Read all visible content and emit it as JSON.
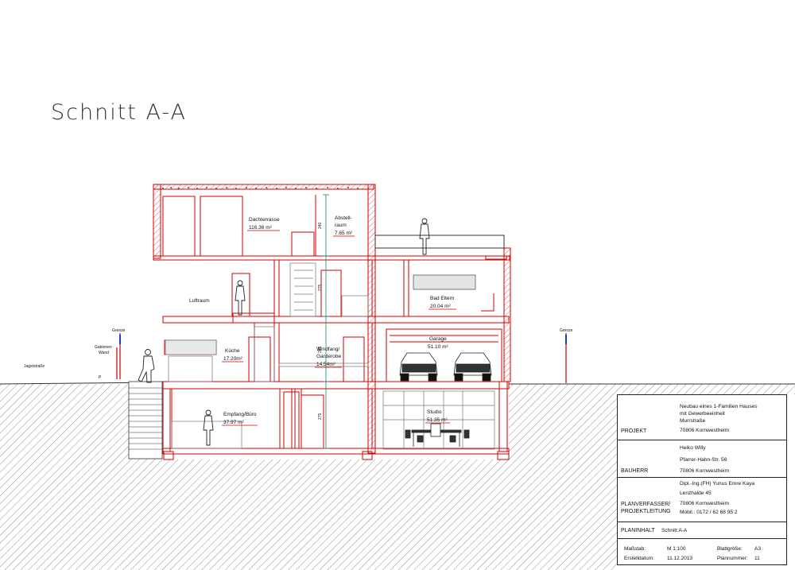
{
  "title": "Schnitt A-A",
  "rooms": {
    "dachterrasse": {
      "name": "Dachterrasse",
      "area": "116.36 m²"
    },
    "abstellraum": {
      "name": "Abstell-\nraum",
      "name_1": "Abstell-",
      "name_2": "raum",
      "area": "7.65 m²"
    },
    "luftraum": {
      "name": "Luftraum"
    },
    "bad_eltern": {
      "name": "Bad Eltern",
      "area": "20.04 m²"
    },
    "kueche": {
      "name": "Küche",
      "area": "17.20m²"
    },
    "windfang": {
      "name_1": "Windfang/",
      "name_2": "Garderobe",
      "area": "14.54m²"
    },
    "garage": {
      "name": "Garage",
      "area": "51.10 m²"
    },
    "empfang": {
      "name": "Empfang/Büro",
      "area": "37.97 m²"
    },
    "studio": {
      "name": "Studio",
      "area": "51.35 m²"
    }
  },
  "site_labels": {
    "grenze_left": "Grenze",
    "grenze_right": "Grenze",
    "gabionen_1": "Gabionen",
    "gabionen_2": "Wand",
    "street": "Jagststraße",
    "marker": "P"
  },
  "dimensions": [
    "240",
    "275",
    "285",
    "275"
  ],
  "title_block": {
    "projekt_label": "PROJEKT",
    "projekt_lines": [
      "Neubau eines 1-Familien Hauses",
      "mit Gewerbeeinheit",
      "Murrstraße",
      "70806 Kornwestheim"
    ],
    "bauherr_label": "BAUHERR",
    "bauherr_lines": [
      "Heiko Willy",
      "Pfarrer-Hahn-Str. 56",
      "70806 Kornwestheim"
    ],
    "planverfasser_label_1": "PLANVERFASSER/",
    "planverfasser_label_2": "PROJEKTLEITUNG",
    "planverfasser_lines": [
      "Dipl.-Ing.(FH) Yunus Emre Kaya",
      "Lenzhalde 45",
      "70806 Kornwestheim",
      "Mobil.: 0172 / 62 68 95 2"
    ],
    "planinhalt_label": "PLANINHALT",
    "planinhalt_value": "Schnitt A-A",
    "massstab_label": "Maßstab:",
    "massstab_value": "M 1:100",
    "blattgroesse_label": "Blattgröße:",
    "blattgroesse_value": "A3",
    "erstelldatum_label": "Erstelldatum:",
    "erstelldatum_value": "11.12.2013",
    "plannummer_label": "Plannummer:",
    "plannummer_value": "11"
  }
}
